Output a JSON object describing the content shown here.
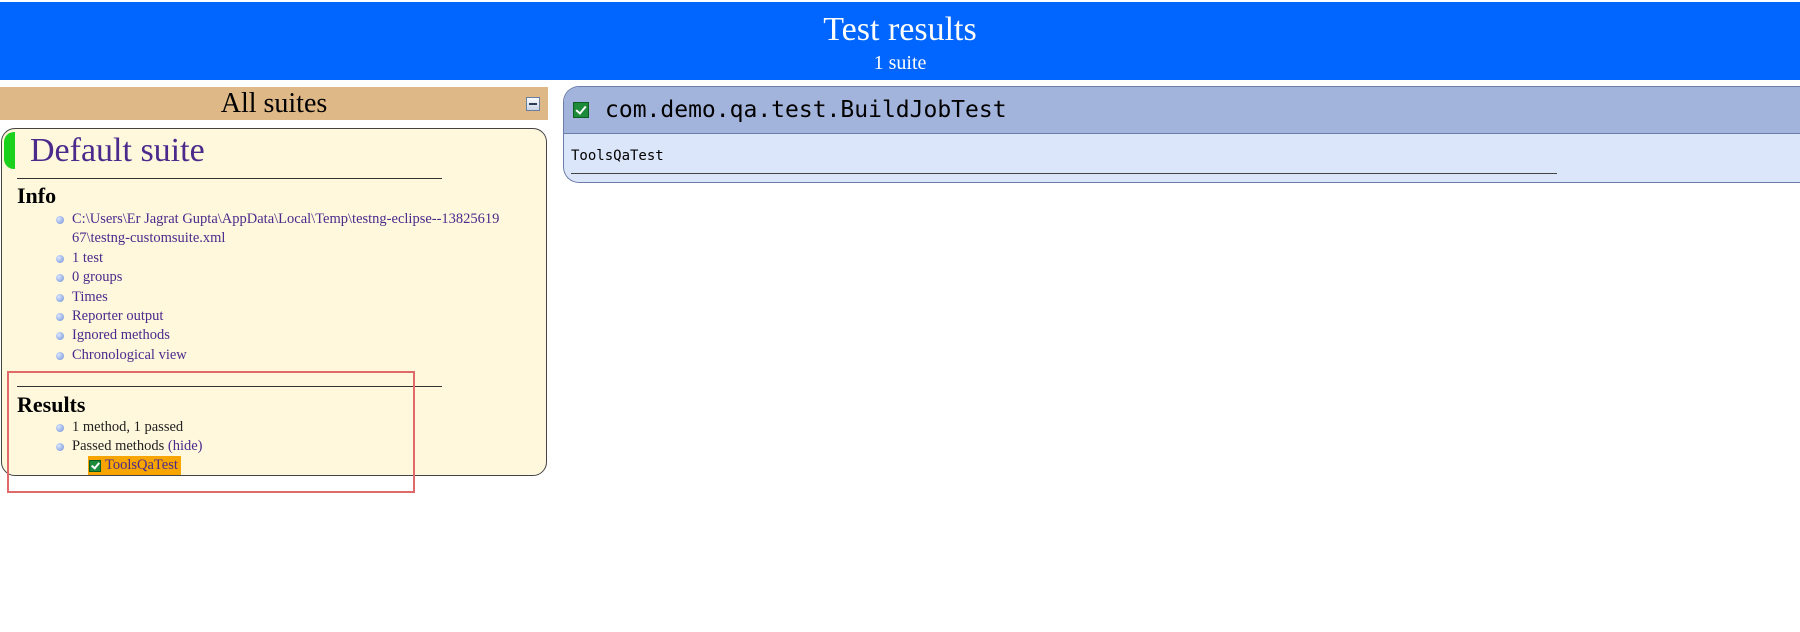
{
  "header": {
    "title": "Test results",
    "subtitle": "1 suite"
  },
  "navigator": {
    "banner_label": "All suites",
    "suite": {
      "name": "Default suite",
      "info": {
        "heading": "Info",
        "items": [
          "C:\\Users\\Er Jagrat Gupta\\AppData\\Local\\Temp\\testng-eclipse--1382561967\\testng-customsuite.xml",
          "1 test",
          "0 groups",
          "Times",
          "Reporter output",
          "Ignored methods",
          "Chronological view"
        ]
      },
      "results": {
        "heading": "Results",
        "summary": "1 method, 1 passed",
        "passed_label": "Passed methods",
        "hide_link": "(hide)",
        "passed_methods": [
          "ToolsQaTest"
        ]
      }
    }
  },
  "main": {
    "class_name": "com.demo.qa.test.BuildJobTest",
    "methods": [
      "ToolsQaTest"
    ]
  },
  "colors": {
    "header_bg": "#0066ff",
    "banner_bg": "#deb887",
    "suite_bg": "#fff8dc",
    "pass_green": "#1cd11c",
    "highlight_orange": "#f8a500",
    "card_head_bg": "#a3b4dc",
    "card_body_bg": "#dce6fa",
    "annotation_red": "#e06a6a"
  }
}
